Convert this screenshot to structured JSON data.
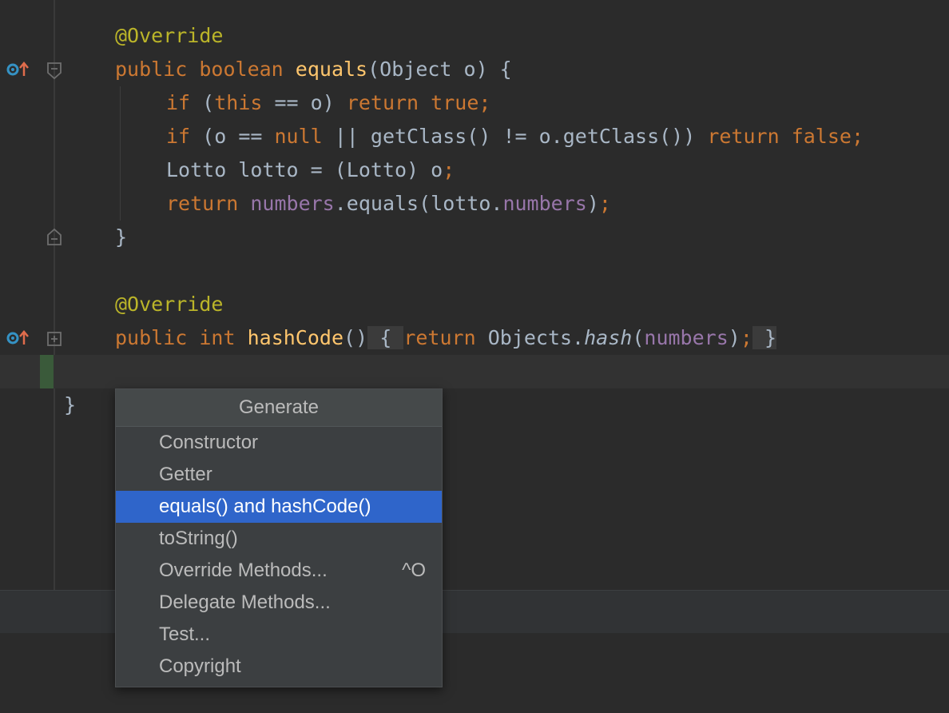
{
  "editor": {
    "code": {
      "l1_annotation": "@Override",
      "l2_public": "public",
      "l2_type": "boolean",
      "l2_name": "equals",
      "l2_params": "(Object o) {",
      "l3_if": "if",
      "l3_mid": " (",
      "l3_this": "this",
      "l3_cond": " == o) ",
      "l3_return": "return",
      "l3_true": "true;",
      "l4_if": "if",
      "l4_cond": " (o == ",
      "l4_null": "null",
      "l4_rest": " || getClass() != o.getClass()) ",
      "l4_return": "return",
      "l4_false": "false;",
      "l5_text": "Lotto lotto = (Lotto) o",
      "l5_semi": ";",
      "l6_return": "return",
      "l6_field1": "numbers",
      "l6_mid": ".equals(lotto.",
      "l6_field2": "numbers",
      "l6_close": ")",
      "l6_semi": ";",
      "l7_brace": "}",
      "l8_annotation": "@Override",
      "l9_public": "public",
      "l9_type": "int",
      "l9_name": "hashCode",
      "l9_parens": "()",
      "l9_open": "{",
      "l9_return": "return",
      "l9_objects": "Objects.",
      "l9_hash": "hash",
      "l9_paren_open": "(",
      "l9_field": "numbers",
      "l9_paren_close": ")",
      "l9_semi": ";",
      "l9_close": "}",
      "class_close": "}"
    },
    "gutter_icons": [
      "override-method-icon",
      "fold-icon",
      "unfold-plus-icon"
    ]
  },
  "generate_popup": {
    "title": "Generate",
    "items": [
      {
        "label": "Constructor",
        "shortcut": ""
      },
      {
        "label": "Getter",
        "shortcut": ""
      },
      {
        "label": "equals() and hashCode()",
        "shortcut": "",
        "selected": true
      },
      {
        "label": "toString()",
        "shortcut": ""
      },
      {
        "label": "Override Methods...",
        "shortcut": "^O"
      },
      {
        "label": "Delegate Methods...",
        "shortcut": ""
      },
      {
        "label": "Test...",
        "shortcut": ""
      },
      {
        "label": "Copyright",
        "shortcut": ""
      }
    ]
  },
  "colors": {
    "background": "#2b2b2b",
    "keyword": "#cc7832",
    "annotation": "#bbb529",
    "method": "#ffc66d",
    "field": "#9876aa",
    "text": "#a9b7c6",
    "selection": "#2f65ca"
  }
}
